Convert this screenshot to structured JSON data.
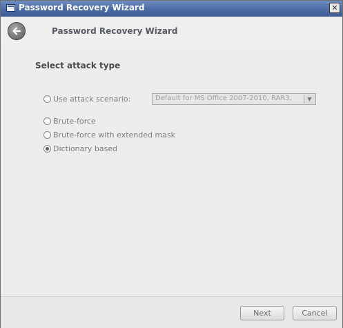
{
  "window": {
    "title": "Password Recovery Wizard",
    "close_glyph": "✕"
  },
  "header": {
    "title": "Password Recovery Wizard",
    "back_icon": "back-arrow-icon"
  },
  "content": {
    "section_title": "Select attack type",
    "options": [
      {
        "label": "Use attack scenario:",
        "checked": false
      },
      {
        "label": "Brute-force",
        "checked": false
      },
      {
        "label": "Brute-force with extended mask",
        "checked": false
      },
      {
        "label": "Dictionary based",
        "checked": true
      }
    ],
    "scenario_select": {
      "value": "Default for MS Office 2007-2010, RAR3,",
      "arrow": "▼"
    }
  },
  "footer": {
    "next_label": "Next",
    "cancel_label": "Cancel"
  }
}
